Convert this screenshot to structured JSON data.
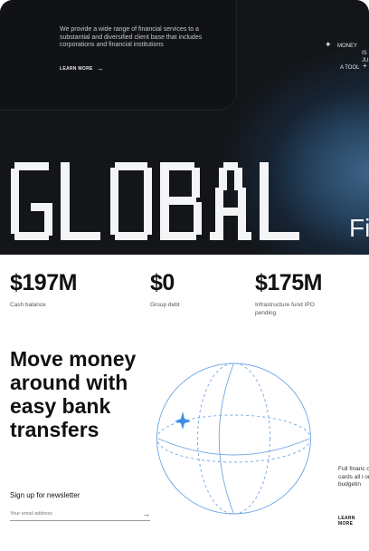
{
  "hero": {
    "description": "We provide a wide range of financial services to a substantial and diversified client base that includes corporations and financial institutions",
    "learn_more": "LEARN MORE",
    "tagline": {
      "line1": "MONEY",
      "line2": "IS JUST",
      "line3": "A TOOL"
    },
    "title_letters": [
      "G",
      "L",
      "O",
      "B",
      "A",
      "L"
    ],
    "title_suffix": "Fi"
  },
  "stats": [
    {
      "value": "$197M",
      "label": "Cash balance"
    },
    {
      "value": "$0",
      "label": "Group debt"
    },
    {
      "value": "$175M",
      "label": "Infrastructure fund IPO pending"
    }
  ],
  "transfer": {
    "headline": "Move money around with easy bank transfers",
    "side_text": "Full financ other ban cards all i on your m budgetin",
    "side_more": "LEARN MORE"
  },
  "newsletter": {
    "label": "Sign up for newsletter",
    "placeholder": "Your email address"
  },
  "colors": {
    "hero_dark": "#131518",
    "hero_glow": "#3f6388",
    "globe_line": "#6fa6e6",
    "globe_star": "#3d8de8"
  }
}
